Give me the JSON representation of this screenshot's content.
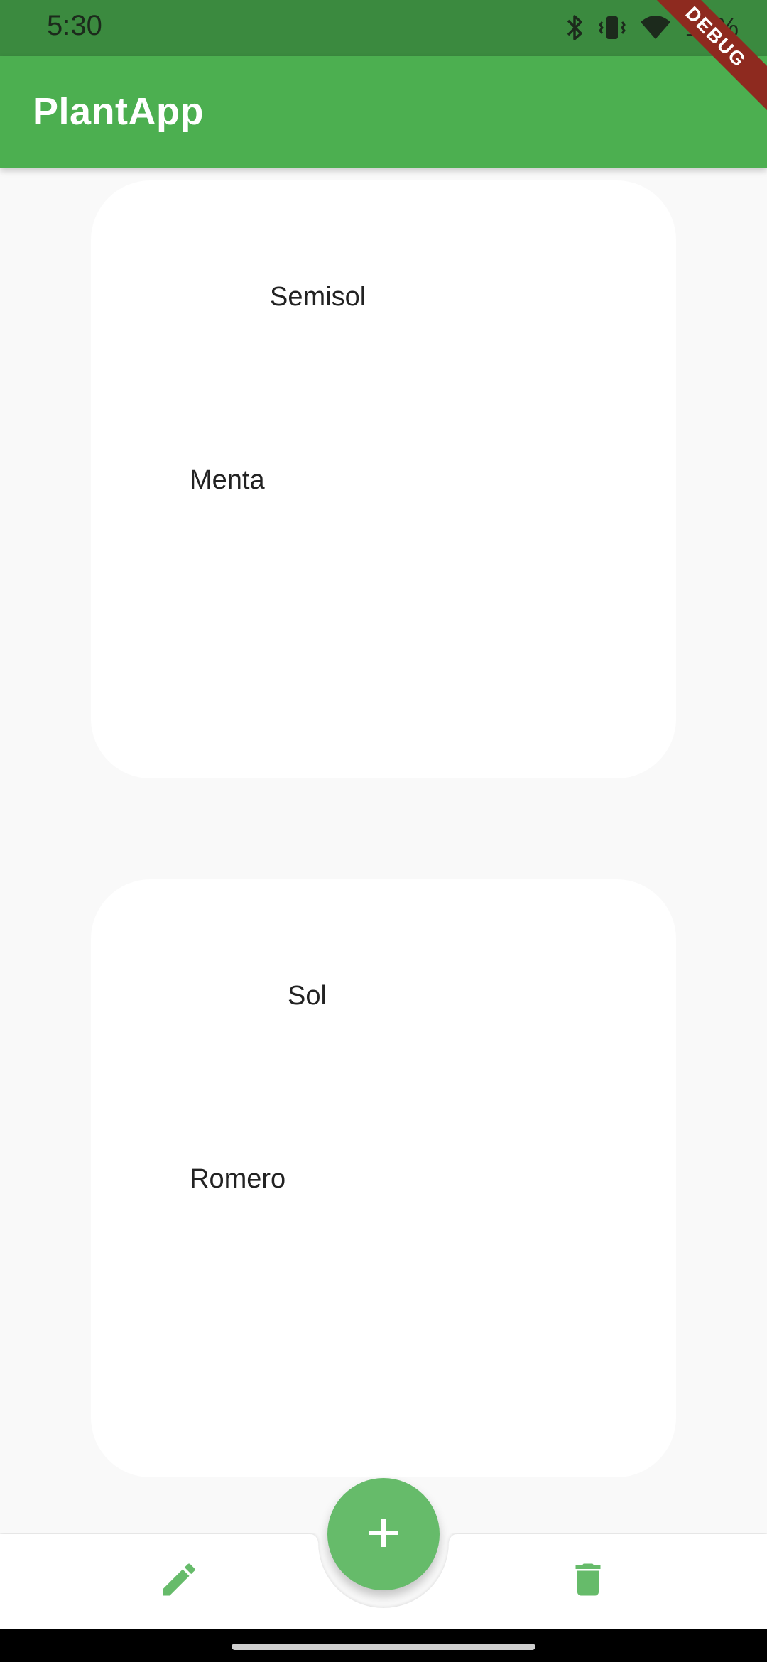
{
  "status_bar": {
    "time": "5:30",
    "battery": "13%"
  },
  "app_bar": {
    "title": "PlantApp"
  },
  "debug_banner": "DEBUG",
  "plants": [
    {
      "sun": "Semisol",
      "name": "Menta"
    },
    {
      "sun": "Sol",
      "name": "Romero"
    }
  ],
  "bottom_nav": {
    "left_icon": "pencil-icon",
    "center_icon": "plus-icon",
    "right_icon": "trash-icon"
  },
  "colors": {
    "primary": "#4caf50",
    "status_bar": "#3b8a3f",
    "fab": "#66bb6a",
    "nav_icon": "#66bb6a",
    "debug": "#8e2a1f"
  }
}
